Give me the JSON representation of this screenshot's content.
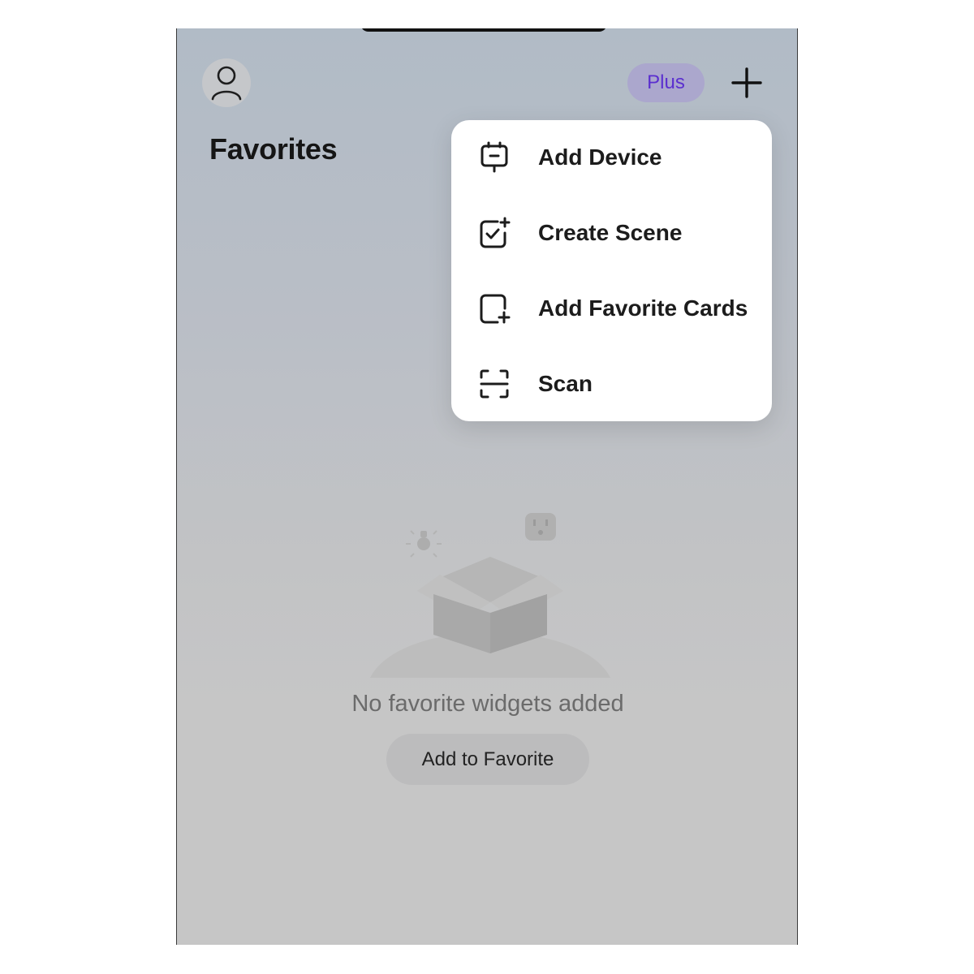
{
  "header": {
    "avatar_icon": "user-icon",
    "plus_badge_label": "Plus",
    "add_icon": "plus-icon",
    "title": "Favorites"
  },
  "menu": {
    "items": [
      {
        "label": "Add Device",
        "icon": "device-icon"
      },
      {
        "label": "Create Scene",
        "icon": "scene-check-icon"
      },
      {
        "label": "Add Favorite Cards",
        "icon": "card-add-icon"
      },
      {
        "label": "Scan",
        "icon": "scan-icon"
      }
    ]
  },
  "empty_state": {
    "illustration": "empty-box-illustration",
    "message": "No favorite widgets added",
    "button_label": "Add to Favorite"
  },
  "colors": {
    "accent_plus_text": "#5b2fcf",
    "plus_badge_bg": "#aba7cd",
    "menu_bg": "#ffffff"
  }
}
